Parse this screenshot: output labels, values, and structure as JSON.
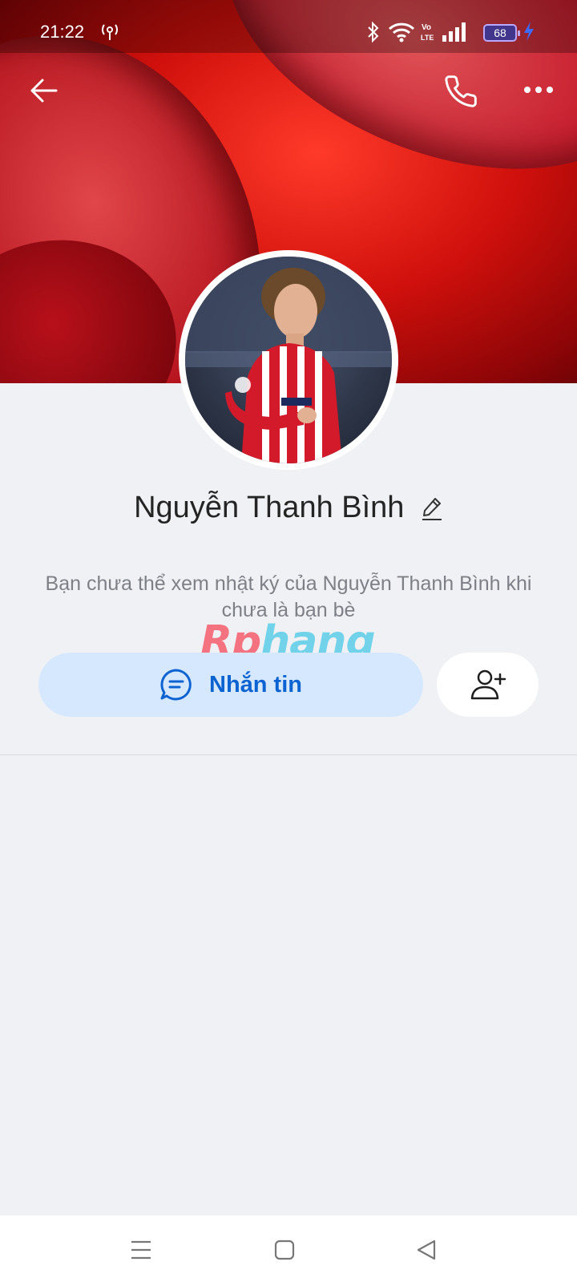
{
  "status_bar": {
    "time": "21:22",
    "battery_level": "68",
    "icons": [
      "hotspot-icon",
      "bluetooth-icon",
      "wifi-icon",
      "volte-icon",
      "signal-icon",
      "battery-icon",
      "charging-icon"
    ]
  },
  "header": {
    "back_icon": "arrow-left-icon",
    "call_icon": "phone-icon",
    "more_icon": "more-horizontal-icon"
  },
  "profile": {
    "name": "Nguyễn Thanh Bình",
    "notice": "Bạn chưa thể xem nhật ký của Nguyễn Thanh Bình khi chưa là bạn bè"
  },
  "watermark": {
    "part1": "Rp",
    "part2": "hang"
  },
  "actions": {
    "message_label": "Nhắn tin",
    "message_icon": "chat-bubble-icon",
    "add_friend_icon": "add-user-icon"
  },
  "colors": {
    "accent": "#0b63d2",
    "message_button_bg": "#d6e8fd",
    "page_bg": "#eff1f5"
  },
  "navbar": {
    "icons": [
      "menu-icon",
      "home-square-icon",
      "back-triangle-icon"
    ]
  }
}
